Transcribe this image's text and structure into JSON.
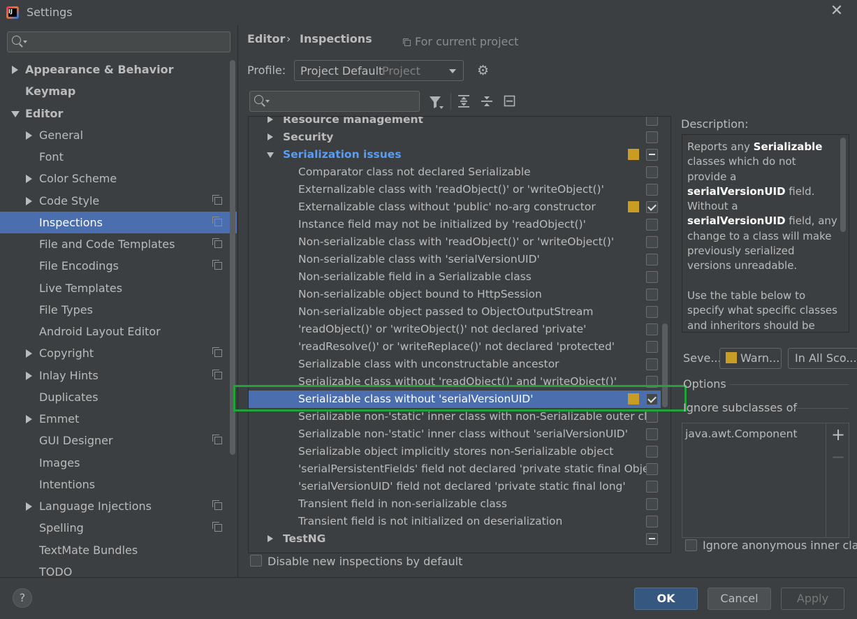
{
  "window": {
    "title": "Settings"
  },
  "sidebar": {
    "items": [
      {
        "label": "Appearance & Behavior",
        "level": 0,
        "arrow": "collapsed",
        "bold": true,
        "copy_icon": false
      },
      {
        "label": "Keymap",
        "level": 0,
        "arrow": "none",
        "bold": true,
        "copy_icon": false
      },
      {
        "label": "Editor",
        "level": 0,
        "arrow": "expanded",
        "bold": true,
        "copy_icon": false
      },
      {
        "label": "General",
        "level": 1,
        "arrow": "collapsed",
        "copy_icon": false
      },
      {
        "label": "Font",
        "level": 1,
        "arrow": "none",
        "copy_icon": false
      },
      {
        "label": "Color Scheme",
        "level": 1,
        "arrow": "collapsed",
        "copy_icon": false
      },
      {
        "label": "Code Style",
        "level": 1,
        "arrow": "collapsed",
        "copy_icon": true
      },
      {
        "label": "Inspections",
        "level": 1,
        "arrow": "none",
        "copy_icon": true,
        "selected": true
      },
      {
        "label": "File and Code Templates",
        "level": 1,
        "arrow": "none",
        "copy_icon": true
      },
      {
        "label": "File Encodings",
        "level": 1,
        "arrow": "none",
        "copy_icon": true
      },
      {
        "label": "Live Templates",
        "level": 1,
        "arrow": "none",
        "copy_icon": false
      },
      {
        "label": "File Types",
        "level": 1,
        "arrow": "none",
        "copy_icon": false
      },
      {
        "label": "Android Layout Editor",
        "level": 1,
        "arrow": "none",
        "copy_icon": false
      },
      {
        "label": "Copyright",
        "level": 1,
        "arrow": "collapsed",
        "copy_icon": true
      },
      {
        "label": "Inlay Hints",
        "level": 1,
        "arrow": "collapsed",
        "copy_icon": true
      },
      {
        "label": "Duplicates",
        "level": 1,
        "arrow": "none",
        "copy_icon": false
      },
      {
        "label": "Emmet",
        "level": 1,
        "arrow": "collapsed",
        "copy_icon": false
      },
      {
        "label": "GUI Designer",
        "level": 1,
        "arrow": "none",
        "copy_icon": true
      },
      {
        "label": "Images",
        "level": 1,
        "arrow": "none",
        "copy_icon": false
      },
      {
        "label": "Intentions",
        "level": 1,
        "arrow": "none",
        "copy_icon": false
      },
      {
        "label": "Language Injections",
        "level": 1,
        "arrow": "collapsed",
        "copy_icon": true
      },
      {
        "label": "Spelling",
        "level": 1,
        "arrow": "none",
        "copy_icon": true
      },
      {
        "label": "TextMate Bundles",
        "level": 1,
        "arrow": "none",
        "copy_icon": false
      },
      {
        "label": "TODO",
        "level": 1,
        "arrow": "none",
        "copy_icon": false
      }
    ]
  },
  "header": {
    "breadcrumb": [
      "Editor",
      "Inspections"
    ],
    "breadcrumb_sep": "›",
    "scope_note": "For current project"
  },
  "profile": {
    "label": "Profile:",
    "name": "Project Default",
    "kind": "Project"
  },
  "tree": {
    "rows": [
      {
        "label": "Resource management",
        "type": "group",
        "arrow": "collapsed",
        "severity": false,
        "check": "off"
      },
      {
        "label": "Security",
        "type": "group",
        "arrow": "collapsed",
        "severity": false,
        "check": "off"
      },
      {
        "label": "Serialization issues",
        "type": "group-blue",
        "arrow": "expanded",
        "severity": true,
        "check": "partial"
      },
      {
        "label": "Comparator class not declared Serializable",
        "type": "item",
        "severity": false,
        "check": "off"
      },
      {
        "label": "Externalizable class with 'readObject()' or 'writeObject()'",
        "type": "item",
        "severity": false,
        "check": "off"
      },
      {
        "label": "Externalizable class without 'public' no-arg constructor",
        "type": "item",
        "severity": true,
        "check": "on"
      },
      {
        "label": "Instance field may not be initialized by 'readObject()'",
        "type": "item",
        "severity": false,
        "check": "off"
      },
      {
        "label": "Non-serializable class with 'readObject()' or 'writeObject()'",
        "type": "item",
        "severity": false,
        "check": "off"
      },
      {
        "label": "Non-serializable class with 'serialVersionUID'",
        "type": "item",
        "severity": false,
        "check": "off"
      },
      {
        "label": "Non-serializable field in a Serializable class",
        "type": "item",
        "severity": false,
        "check": "off"
      },
      {
        "label": "Non-serializable object bound to HttpSession",
        "type": "item",
        "severity": false,
        "check": "off"
      },
      {
        "label": "Non-serializable object passed to ObjectOutputStream",
        "type": "item",
        "severity": false,
        "check": "off"
      },
      {
        "label": "'readObject()' or 'writeObject()' not declared 'private'",
        "type": "item",
        "severity": false,
        "check": "off"
      },
      {
        "label": "'readResolve()' or 'writeReplace()' not declared 'protected'",
        "type": "item",
        "severity": false,
        "check": "off"
      },
      {
        "label": "Serializable class with unconstructable ancestor",
        "type": "item",
        "severity": false,
        "check": "off"
      },
      {
        "label": "Serializable class without 'readObject()' and 'writeObject()'",
        "type": "item",
        "severity": false,
        "check": "off"
      },
      {
        "label": "Serializable class without 'serialVersionUID'",
        "type": "item",
        "severity": true,
        "check": "on",
        "selected": true
      },
      {
        "label": "Serializable non-'static' inner class with non-Serializable outer cla",
        "type": "item",
        "severity": false,
        "check": "off"
      },
      {
        "label": "Serializable non-'static' inner class without 'serialVersionUID'",
        "type": "item",
        "severity": false,
        "check": "off"
      },
      {
        "label": "Serializable object implicitly stores non-Serializable object",
        "type": "item",
        "severity": false,
        "check": "off"
      },
      {
        "label": "'serialPersistentFields' field not declared 'private static final Obje",
        "type": "item",
        "severity": false,
        "check": "off"
      },
      {
        "label": "'serialVersionUID' field not declared 'private static final long'",
        "type": "item",
        "severity": false,
        "check": "off"
      },
      {
        "label": "Transient field in non-serializable class",
        "type": "item",
        "severity": false,
        "check": "off"
      },
      {
        "label": "Transient field is not initialized on deserialization",
        "type": "item",
        "severity": false,
        "check": "off"
      },
      {
        "label": "TestNG",
        "type": "group",
        "arrow": "collapsed",
        "severity": false,
        "check": "partial"
      }
    ]
  },
  "disable_new": {
    "label": "Disable new inspections by default",
    "checked": false
  },
  "description": {
    "label": "Description:",
    "html": "Reports any <b>Serializable</b> classes which do not provide a <b>serialVersionUID</b> field. Without a <b>serialVersionUID</b> field, any change to a class will make previously serialized versions unreadable.<br><br>Use the table below to specify what specific classes and inheritors should be excluded from being"
  },
  "severity": {
    "label": "Seve...",
    "value": "Warn...",
    "scope": "In All Sco..."
  },
  "options": {
    "label": "Options",
    "ignore_subclasses_label": "Ignore subclasses of",
    "list_items": [
      "java.awt.Component"
    ],
    "add": "+",
    "remove": "−",
    "ignore_anonymous_label": "Ignore anonymous inner cla...",
    "ignore_anonymous_checked": false
  },
  "buttons": {
    "help": "?",
    "ok": "OK",
    "cancel": "Cancel",
    "apply": "Apply"
  },
  "colors": {
    "background": "#3c3f41",
    "selection": "#4b6eaf",
    "warning": "#c99c23",
    "group_link": "#589df6",
    "highlight_frame": "#22a33a",
    "ok_button": "#365880"
  }
}
